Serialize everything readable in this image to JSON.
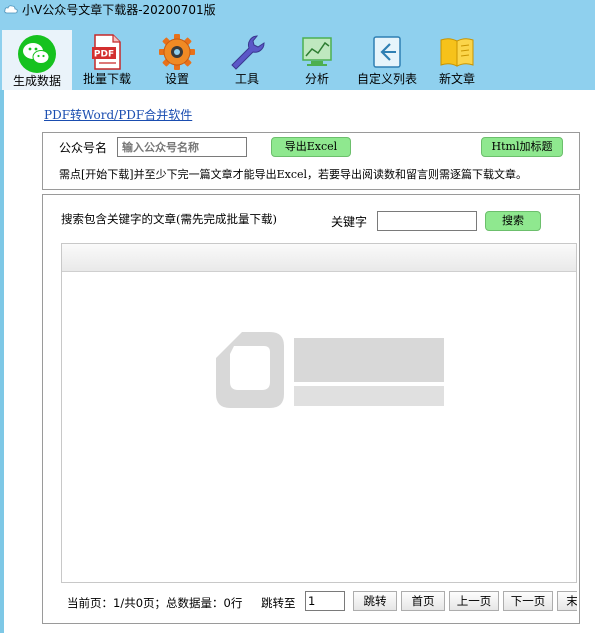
{
  "window": {
    "title": "小V公众号文章下载器-20200701版"
  },
  "toolbar": {
    "items": [
      {
        "label": "生成数据",
        "icon": "wechat-icon"
      },
      {
        "label": "批量下载",
        "icon": "pdf-icon"
      },
      {
        "label": "设置",
        "icon": "gear-icon"
      },
      {
        "label": "工具",
        "icon": "wrench-icon"
      },
      {
        "label": "分析",
        "icon": "chart-icon"
      },
      {
        "label": "自定义列表",
        "icon": "custom-list-icon"
      },
      {
        "label": "新文章",
        "icon": "book-icon"
      }
    ]
  },
  "main": {
    "pdf_link": "PDF转Word/PDF合并软件",
    "account_label": "公众号名",
    "account_placeholder": "输入公众号名称",
    "export_excel": "导出Excel",
    "html_title": "Html加标题",
    "notice": "需点[开始下载]并至少下完一篇文章才能导出Excel，若要导出阅读数和留言则需逐篇下载文章。",
    "search_title": "搜索包含关键字的文章(需先完成批量下载)",
    "keyword_label": "关键字",
    "keyword_value": "",
    "search_button": "搜索"
  },
  "pager": {
    "info": "当前页：1/共0页；总数据量：0行",
    "jump_label": "跳转至",
    "page_value": "1",
    "jump": "跳转",
    "first": "首页",
    "prev": "上一页",
    "next": "下一页",
    "last": "末"
  },
  "colors": {
    "toolbar_bg": "#8fd0ee",
    "button_green": "#8fe88f",
    "link": "#1a4db0"
  }
}
